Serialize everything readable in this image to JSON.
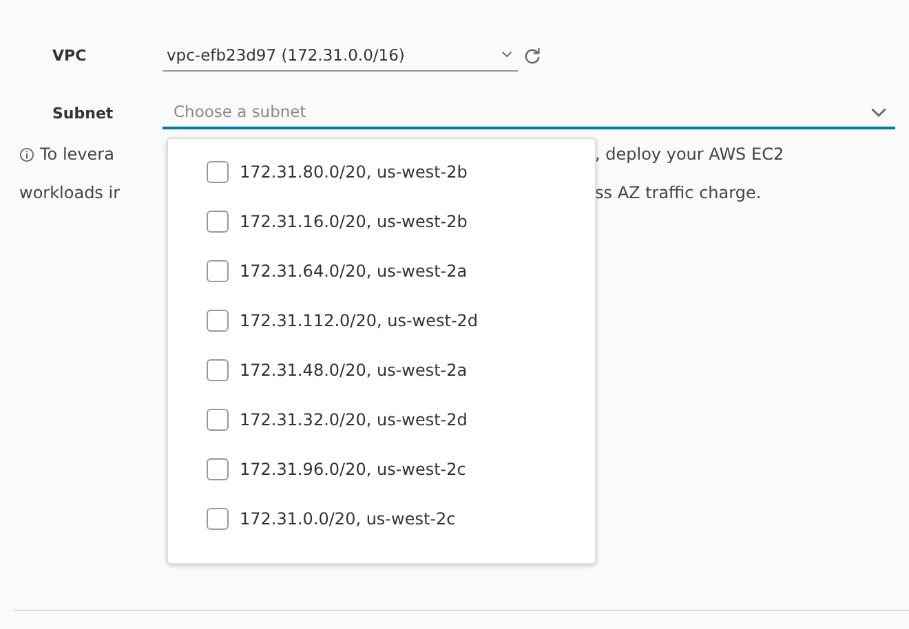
{
  "vpc": {
    "label": "VPC",
    "value": "vpc-efb23d97 (172.31.0.0/16)"
  },
  "subnet": {
    "label": "Subnet",
    "placeholder": "Choose a subnet",
    "expanded": true,
    "options": [
      {
        "label": "172.31.80.0/20, us-west-2b",
        "checked": false
      },
      {
        "label": "172.31.16.0/20, us-west-2b",
        "checked": false
      },
      {
        "label": "172.31.64.0/20, us-west-2a",
        "checked": false
      },
      {
        "label": "172.31.112.0/20, us-west-2d",
        "checked": false
      },
      {
        "label": "172.31.48.0/20, us-west-2a",
        "checked": false
      },
      {
        "label": "172.31.32.0/20, us-west-2d",
        "checked": false
      },
      {
        "label": "172.31.96.0/20, us-west-2c",
        "checked": false
      },
      {
        "label": "172.31.0.0/20, us-west-2c",
        "checked": false
      }
    ]
  },
  "info": {
    "lines": [
      {
        "left": "To levera",
        "right": ", deploy your AWS EC2"
      },
      {
        "left": "workloads ir",
        "right": "ss AZ traffic charge."
      }
    ]
  }
}
